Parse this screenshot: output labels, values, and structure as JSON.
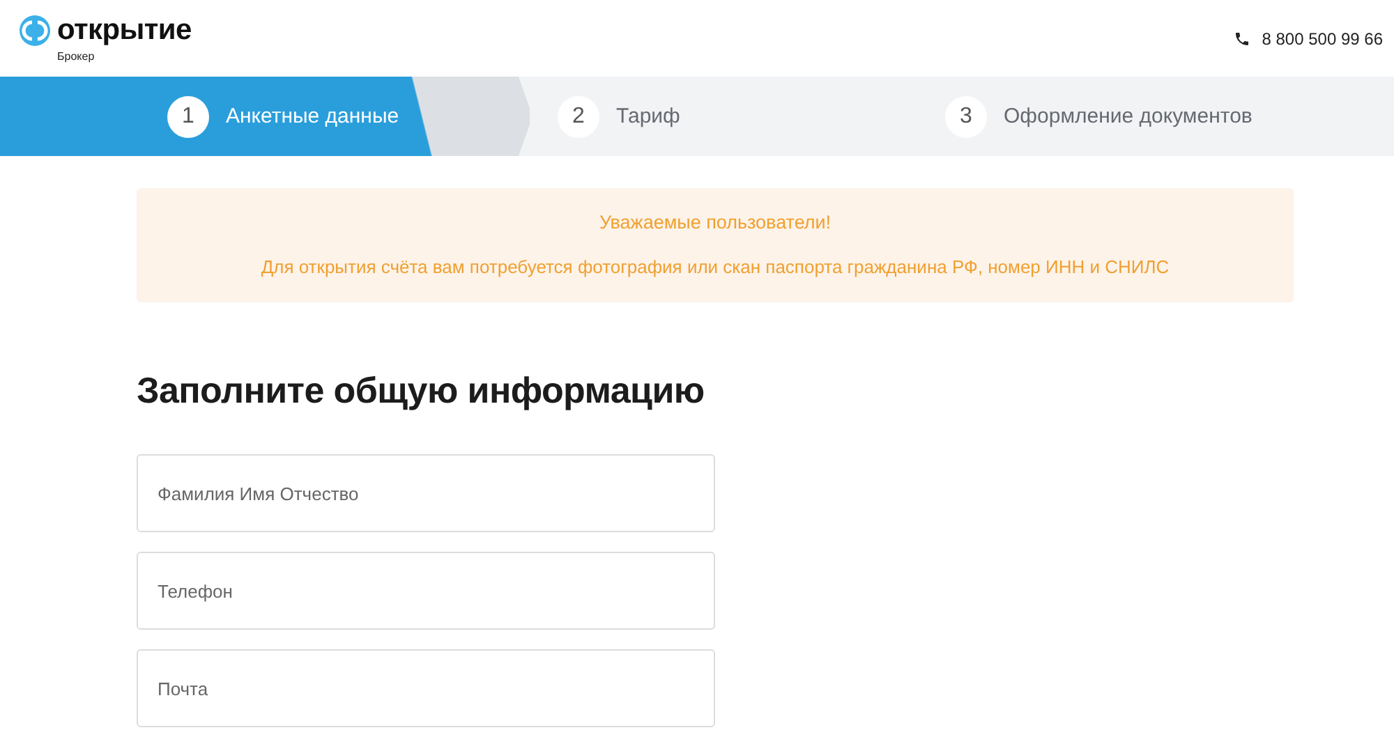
{
  "header": {
    "logo_text": "открытие",
    "logo_subtitle": "Брокер",
    "phone": "8 800 500 99 66"
  },
  "steps": [
    {
      "number": "1",
      "label": "Анкетные данные",
      "selected": true
    },
    {
      "number": "2",
      "label": "Тариф",
      "selected": false
    },
    {
      "number": "3",
      "label": "Оформление документов",
      "selected": false
    }
  ],
  "notice": {
    "title": "Уважаемые пользователи!",
    "text": "Для открытия счёта вам потребуется фотография или скан паспорта гражданина РФ, номер ИНН и СНИЛС"
  },
  "form": {
    "title": "Заполните общую информацию",
    "fields": [
      {
        "placeholder": "Фамилия Имя Отчество"
      },
      {
        "placeholder": "Телефон"
      },
      {
        "placeholder": "Почта"
      }
    ]
  }
}
